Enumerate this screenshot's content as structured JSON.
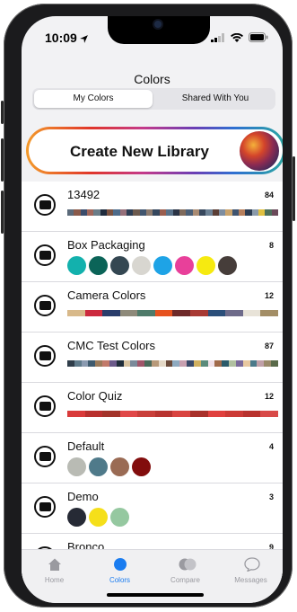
{
  "status_bar": {
    "time": "10:09"
  },
  "header": {
    "title": "Colors"
  },
  "segments": {
    "my_colors": "My Colors",
    "shared": "Shared With You"
  },
  "create_button": {
    "label": "Create New Library"
  },
  "libraries": [
    {
      "name": "13492",
      "count": "84",
      "type": "strip",
      "colors": [
        "#5b6a7a",
        "#8a5a4a",
        "#3b4c6b",
        "#a0665a",
        "#6a7d88",
        "#1f2b3d",
        "#7a5140",
        "#4d6b8a",
        "#96707a",
        "#2d3e55",
        "#6d5a4e",
        "#41566f",
        "#8c7a6e",
        "#35475e",
        "#9a5e4f",
        "#587189",
        "#2a3345",
        "#7f6a5b",
        "#4a5f77",
        "#a98b73",
        "#38485d",
        "#6c8194",
        "#5a3e35",
        "#7d8da0",
        "#c9a26a",
        "#3f5470",
        "#b67f5c",
        "#2b3c52",
        "#8a9aaa",
        "#e0c040",
        "#4b6f5a",
        "#6b4a5a"
      ]
    },
    {
      "name": "Box Packaging",
      "count": "8",
      "type": "dots",
      "colors": [
        "#13b1ad",
        "#0b6458",
        "#344752",
        "#d8d6d0",
        "#1ea3e6",
        "#e8409a",
        "#f6ea10",
        "#463d3a"
      ]
    },
    {
      "name": "Camera Colors",
      "count": "12",
      "type": "strip",
      "colors": [
        "#d8b98a",
        "#cc2a3e",
        "#2a3d6b",
        "#8e8a7a",
        "#4f7b6a",
        "#e6521f",
        "#6e2a2a",
        "#a83a34",
        "#2b4f7a",
        "#6e6b8a",
        "#e8e3d8",
        "#a38e66"
      ]
    },
    {
      "name": "CMC Test Colors",
      "count": "87",
      "type": "strip",
      "colors": [
        "#2f3d4a",
        "#5f7a8a",
        "#8a9ab0",
        "#3e5a6e",
        "#9a7a5a",
        "#c27a6a",
        "#6b5a8a",
        "#1f2d3a",
        "#d6c2a0",
        "#7a8a9a",
        "#a0566a",
        "#4a6a5a",
        "#b89a7a",
        "#e4d8c6",
        "#6a4a3a",
        "#8eaac0",
        "#c8a0b0",
        "#3a4a6a",
        "#d0b060",
        "#5a8a7a",
        "#f0e0e8",
        "#a06a4a",
        "#2a5a6a",
        "#b0c0a0",
        "#7a6a9a",
        "#e8c8a0",
        "#4a7a8a",
        "#c0a0a8",
        "#9a8a6a",
        "#5a6a4a"
      ]
    },
    {
      "name": "Color Quiz",
      "count": "12",
      "type": "strip",
      "colors": [
        "#d93a3a",
        "#b8302e",
        "#a3342a",
        "#e04848",
        "#c93f3a",
        "#b83430",
        "#d94440",
        "#a8302a",
        "#e0403e",
        "#cc3a36",
        "#b8322e",
        "#d84a48"
      ]
    },
    {
      "name": "Default",
      "count": "4",
      "type": "dots",
      "colors": [
        "#b9bbb4",
        "#4f7a8a",
        "#9a6b54",
        "#820d0d"
      ]
    },
    {
      "name": "Demo",
      "count": "3",
      "type": "dots",
      "colors": [
        "#262a35",
        "#f5df1a",
        "#95c8a0"
      ]
    },
    {
      "name": "Bronco",
      "count": "9",
      "type": "strip",
      "colors": []
    }
  ],
  "tabs": [
    {
      "label": "Home",
      "icon": "home-icon"
    },
    {
      "label": "Colors",
      "icon": "colors-icon"
    },
    {
      "label": "Compare",
      "icon": "compare-icon"
    },
    {
      "label": "Messages",
      "icon": "messages-icon"
    }
  ],
  "accent": "#1a7cf0"
}
